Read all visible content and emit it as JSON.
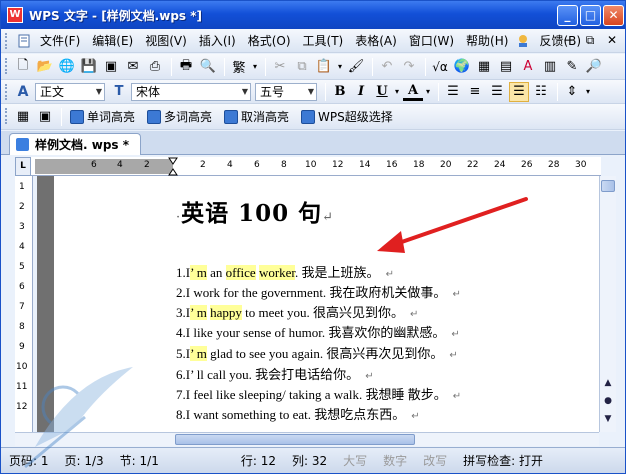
{
  "window": {
    "title": "WPS 文字 - [样例文档.wps *]",
    "app_icon": "W"
  },
  "menu": {
    "items": [
      "文件(F)",
      "编辑(E)",
      "视图(V)",
      "插入(I)",
      "格式(O)",
      "工具(T)",
      "表格(A)",
      "窗口(W)",
      "帮助(H)"
    ],
    "feedback": "反馈(B)"
  },
  "format_bar": {
    "style": "正文",
    "font": "宋体",
    "size": "五号",
    "bold": "B",
    "italic": "I",
    "underline": "U",
    "font_color": "A"
  },
  "plugin_bar": {
    "buttons": [
      "单词高亮",
      "多词高亮",
      "取消高亮",
      "WPS超级选择"
    ]
  },
  "tab": {
    "label": "样例文档. wps *"
  },
  "ruler": {
    "corner": "L",
    "h_numbers": [
      "6",
      "4",
      "2",
      "2",
      "4",
      "6",
      "8",
      "10",
      "12",
      "14",
      "16",
      "18",
      "20",
      "22",
      "24",
      "26",
      "28",
      "30"
    ],
    "v_numbers": [
      "1",
      "2",
      "3",
      "4",
      "5",
      "6",
      "7",
      "8",
      "9",
      "10",
      "11",
      "12"
    ]
  },
  "document": {
    "title": "英语 100 句",
    "line1": {
      "pre": "1.I",
      "h1": "’ m",
      "mid1": " an ",
      "h2": "office",
      "mid2": " ",
      "h3": "worker",
      "post": ". 我是上班族。"
    },
    "line2": "2.I work for the government. 我在政府机关做事。",
    "line3": {
      "pre": "3.I",
      "h1": "’ m",
      "mid": " ",
      "h2": "happy",
      "post": " to meet you. 很高兴见到你。"
    },
    "line4": "4.I like your sense of humor. 我喜欢你的幽默感。",
    "line5": {
      "pre": "5.I",
      "h1": "’ m",
      "post": " glad to see you again. 很高兴再次见到你。"
    },
    "line6": "6.I’ ll call you. 我会打电话给你。",
    "line7": "7.I feel like sleeping/ taking a walk. 我想睡 散步。",
    "line8": "8.I want something to eat. 我想吃点东西。",
    "paragraph_mark": "↵"
  },
  "status": {
    "page": "页码: 1",
    "pages": "页: 1/3",
    "section": "节: 1/1",
    "row": "行: 12",
    "col": "列: 32",
    "caps": "大写",
    "num": "数字",
    "overwrite": "改写",
    "spell": "拼写检查: 打开"
  },
  "colors": {
    "accent": "#1250d8",
    "highlight": "#ffff99",
    "arrow": "#e02020"
  }
}
